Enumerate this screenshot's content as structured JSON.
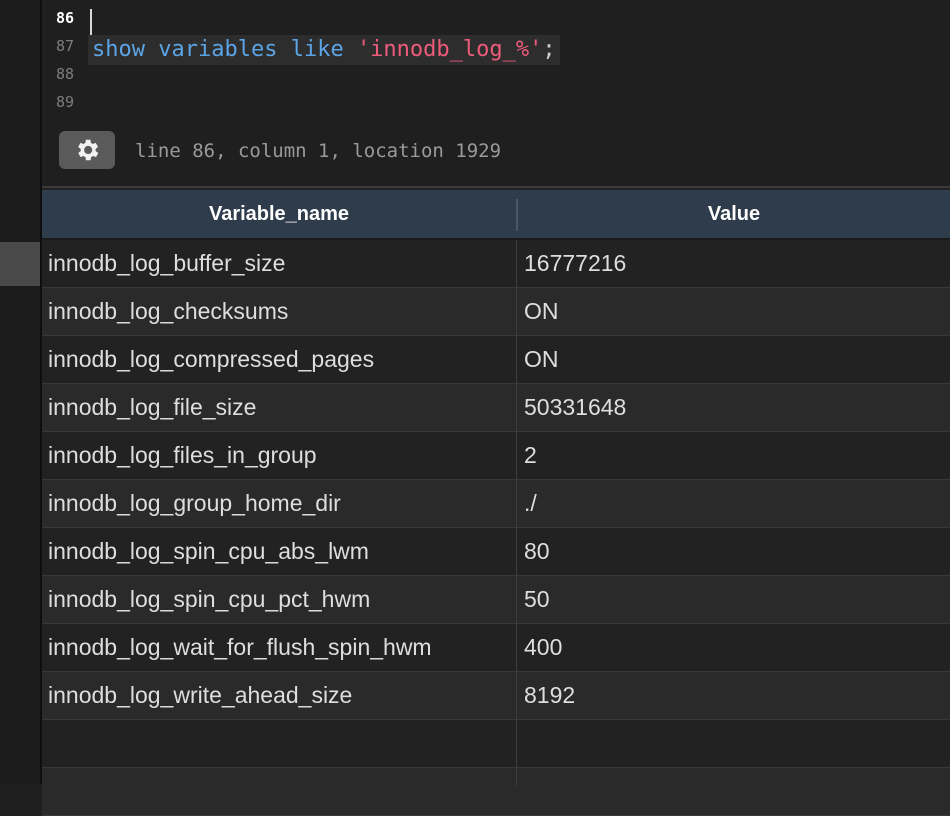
{
  "editor": {
    "lines": [
      {
        "number": "86",
        "current": true
      },
      {
        "number": "87",
        "tokens": [
          {
            "text": "show",
            "kind": "keyword"
          },
          {
            "text": " ",
            "kind": "space"
          },
          {
            "text": "variables",
            "kind": "keyword"
          },
          {
            "text": " ",
            "kind": "space"
          },
          {
            "text": "like",
            "kind": "keyword"
          },
          {
            "text": " ",
            "kind": "space"
          },
          {
            "text": "'innodb_log_%'",
            "kind": "string"
          },
          {
            "text": ";",
            "kind": "punct"
          }
        ]
      },
      {
        "number": "88"
      },
      {
        "number": "89"
      }
    ]
  },
  "status": {
    "gear_icon": "gear-icon",
    "text": "line 86, column 1, location 1929"
  },
  "grid": {
    "columns": [
      "Variable_name",
      "Value"
    ],
    "rows": [
      [
        "innodb_log_buffer_size",
        "16777216"
      ],
      [
        "innodb_log_checksums",
        "ON"
      ],
      [
        "innodb_log_compressed_pages",
        "ON"
      ],
      [
        "innodb_log_file_size",
        "50331648"
      ],
      [
        "innodb_log_files_in_group",
        "2"
      ],
      [
        "innodb_log_group_home_dir",
        "./"
      ],
      [
        "innodb_log_spin_cpu_abs_lwm",
        "80"
      ],
      [
        "innodb_log_spin_cpu_pct_hwm",
        "50"
      ],
      [
        "innodb_log_wait_for_flush_spin_hwm",
        "400"
      ],
      [
        "innodb_log_write_ahead_size",
        "8192"
      ],
      [
        "",
        ""
      ],
      [
        "",
        ""
      ]
    ]
  },
  "colors": {
    "keyword": "#5ba4e5",
    "string": "#ef5b7b",
    "header_bg": "#2f3c4c"
  }
}
